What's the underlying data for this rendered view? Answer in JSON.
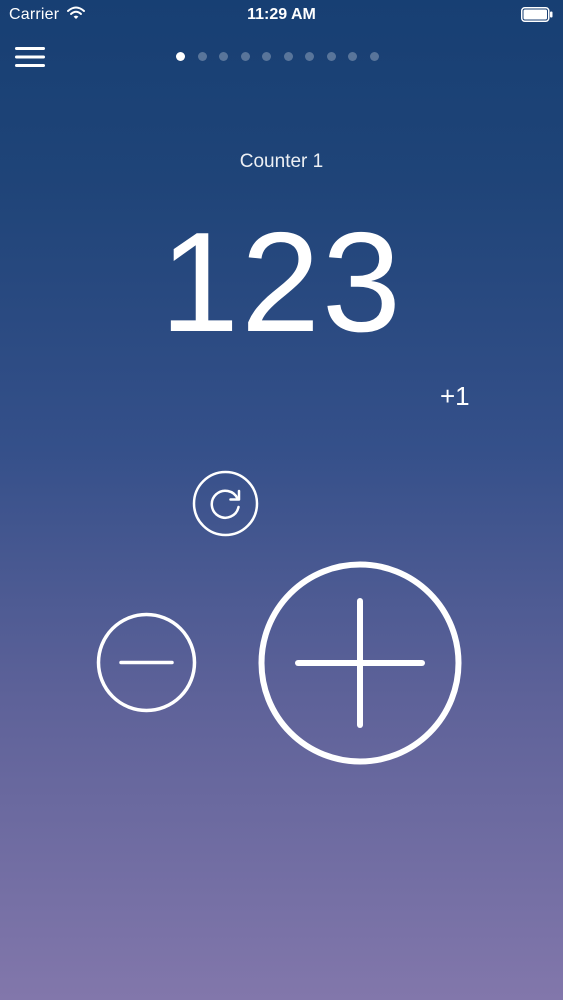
{
  "status_bar": {
    "carrier": "Carrier",
    "time": "11:29 AM",
    "wifi_icon": "wifi-icon",
    "battery_icon": "battery-icon"
  },
  "header": {
    "menu_icon": "hamburger-menu-icon",
    "page_count": 10,
    "active_page": 1
  },
  "counter": {
    "name": "Counter 1",
    "value": "123",
    "step_label": "+1"
  },
  "controls": {
    "reset_icon": "reset-icon",
    "decrement_icon": "minus-icon",
    "increment_icon": "plus-icon"
  },
  "colors": {
    "gradient_top": "#173f73",
    "gradient_bottom": "#8277ab",
    "foreground": "#ffffff"
  }
}
